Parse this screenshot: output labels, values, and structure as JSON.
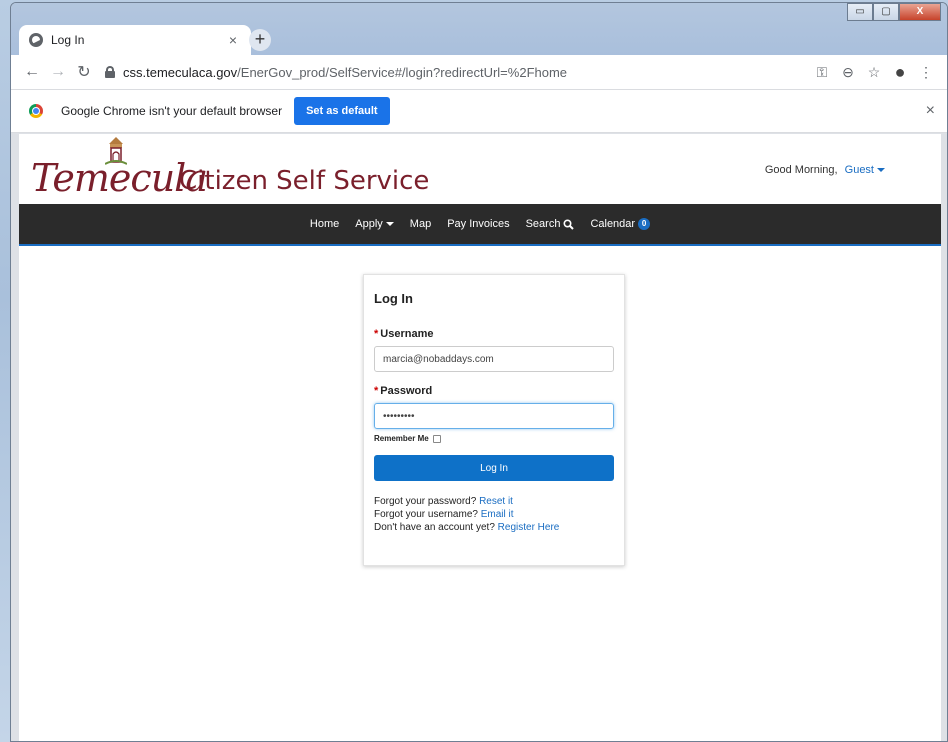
{
  "browser": {
    "tab_title": "Log In",
    "tab_close": "×",
    "new_tab": "+",
    "url_host": "css.temeculaca.gov",
    "url_path": "/EnerGov_prod/SelfService#/login?redirectUrl=%2Fhome",
    "win_minimize": "▭",
    "win_maximize": "▢",
    "win_close": "X"
  },
  "infobar": {
    "text": "Google Chrome isn't your default browser",
    "button": "Set as default",
    "close": "×"
  },
  "site": {
    "logo_script": "Temecula",
    "title": "Citizen Self Service",
    "greeting": "Good Morning,",
    "user": "Guest"
  },
  "nav": {
    "home": "Home",
    "apply": "Apply",
    "map": "Map",
    "pay_invoices": "Pay Invoices",
    "search": "Search",
    "calendar": "Calendar",
    "calendar_count": "0"
  },
  "login": {
    "title": "Log In",
    "required_mark": "*",
    "username_label": "Username",
    "username_value": "marcia@nobaddays.com",
    "password_label": "Password",
    "password_value": "•••••••••",
    "remember_label": "Remember Me",
    "button": "Log In",
    "forgot_password_text": "Forgot your password?",
    "forgot_password_link": "Reset it",
    "forgot_username_text": "Forgot your username?",
    "forgot_username_link": "Email it",
    "no_account_text": "Don't have an account yet?",
    "register_link": "Register Here"
  },
  "colors": {
    "brand_maroon": "#7a1f2b",
    "link_blue": "#1a6dc2",
    "primary_button": "#0e71c8",
    "navbar_bg": "#2b2b2b"
  }
}
